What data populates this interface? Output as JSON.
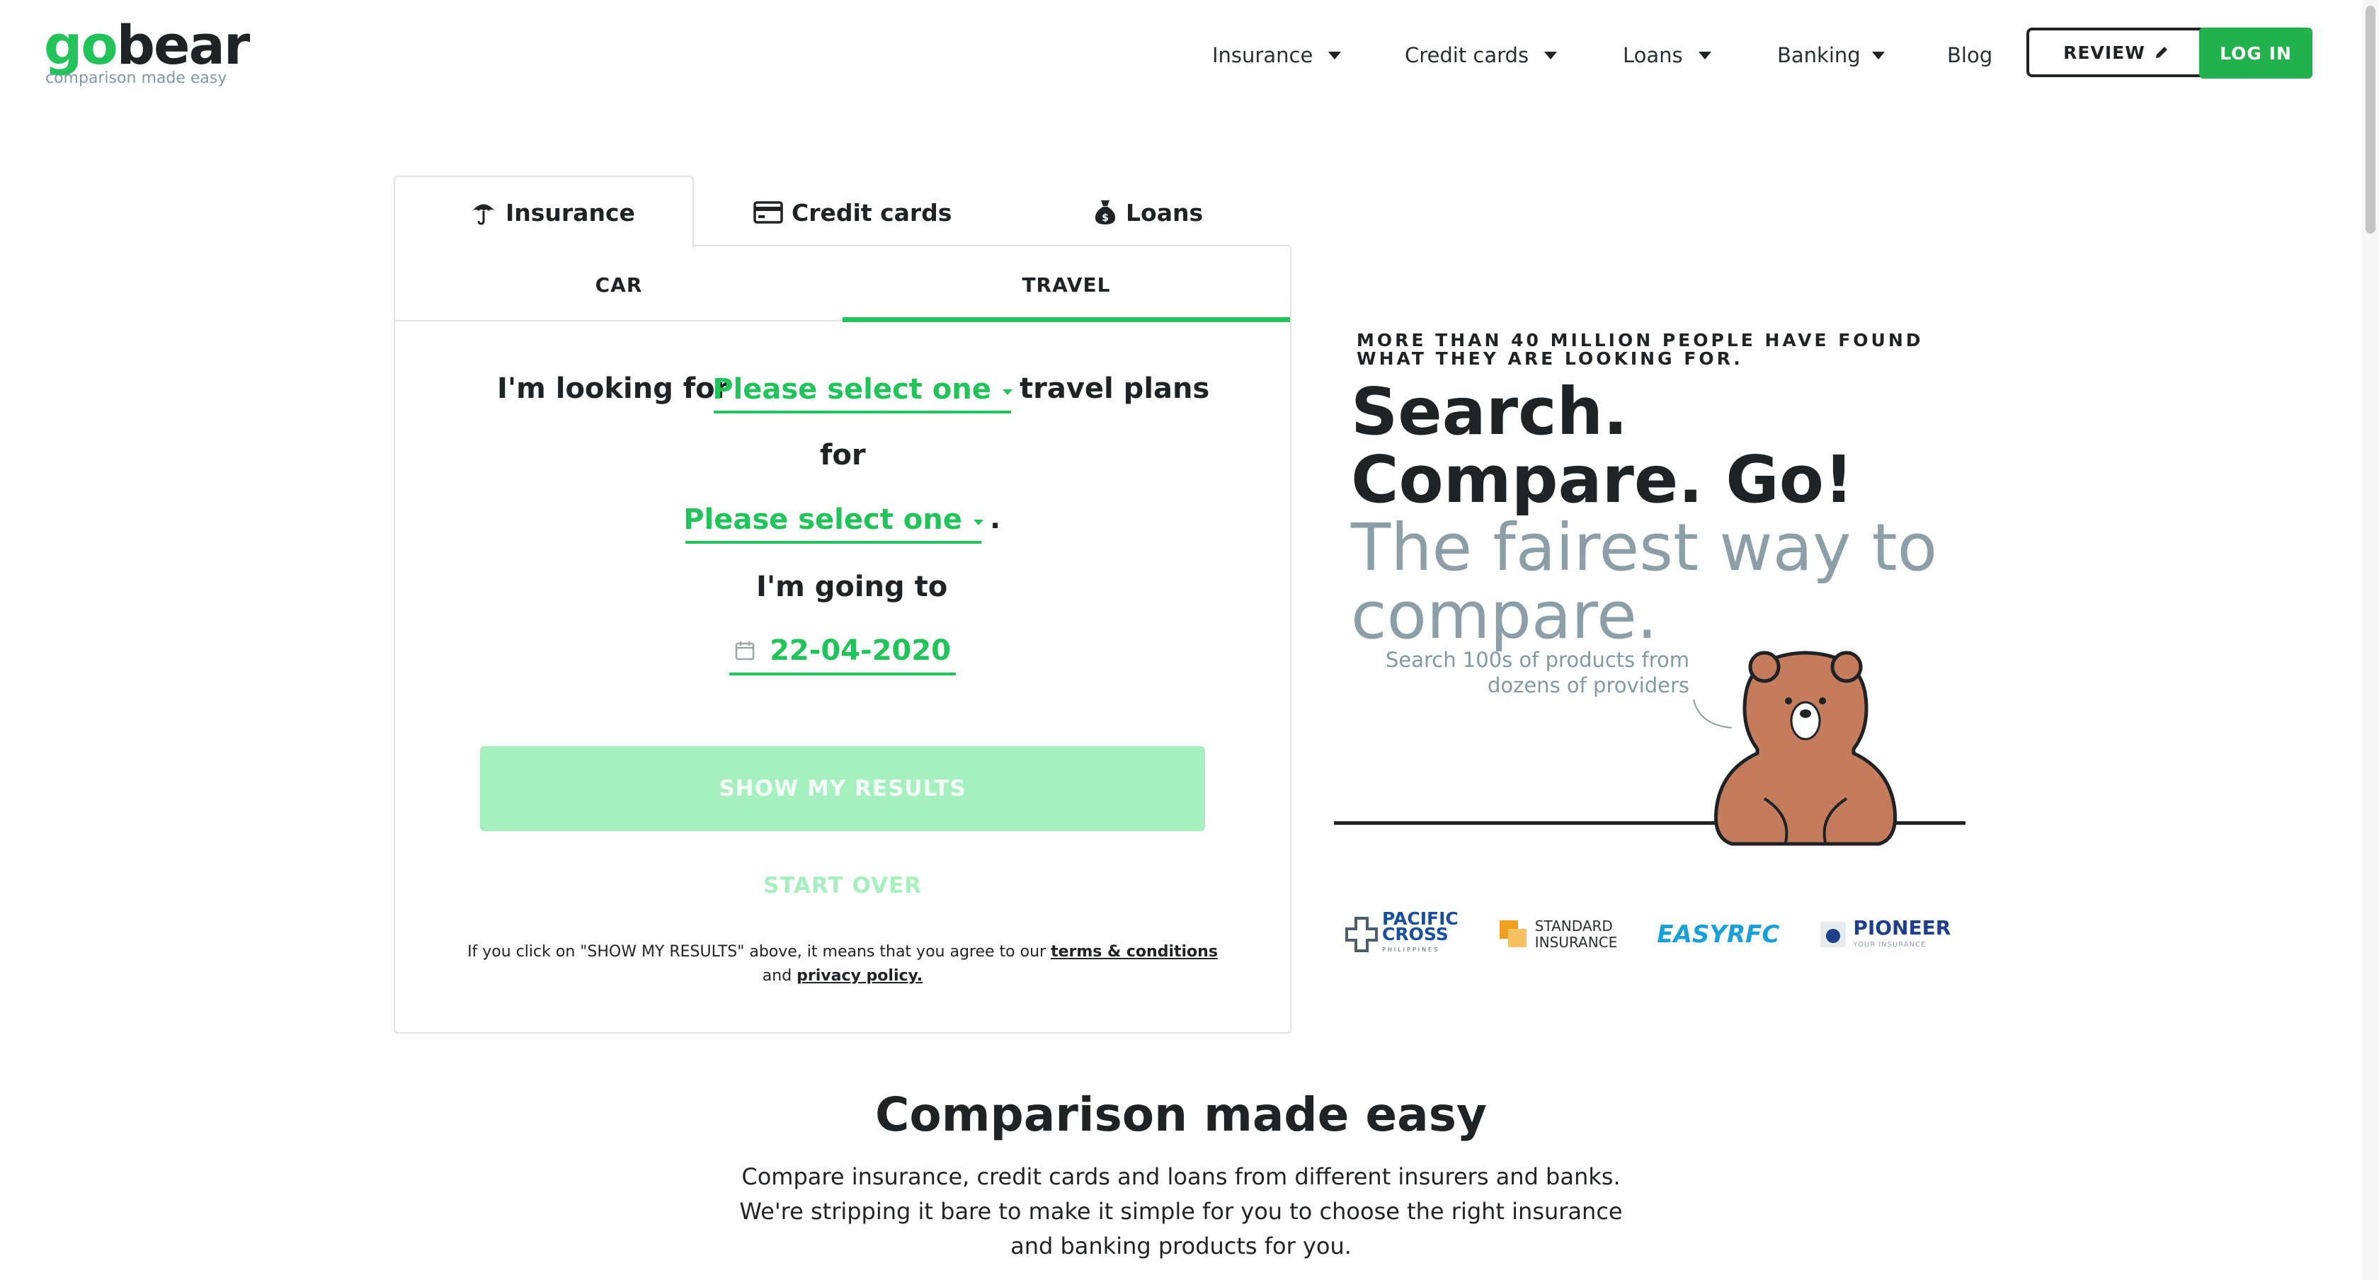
{
  "logo": {
    "word_go": "go",
    "word_bear": "bear",
    "tagline": "comparison made easy"
  },
  "nav": {
    "items": [
      {
        "label": "Insurance",
        "dropdown": true
      },
      {
        "label": "Credit cards",
        "dropdown": true
      },
      {
        "label": "Loans",
        "dropdown": true
      },
      {
        "label": "Banking",
        "dropdown": true
      },
      {
        "label": "Blog",
        "dropdown": false
      }
    ],
    "review_label": "REVIEW",
    "login_label": "LOG IN"
  },
  "search": {
    "tabs": [
      {
        "label": "Insurance",
        "icon": "umbrella-icon",
        "active": true
      },
      {
        "label": "Credit cards",
        "icon": "credit-card-icon",
        "active": false
      },
      {
        "label": "Loans",
        "icon": "money-bag-icon",
        "active": false
      }
    ],
    "subtabs": [
      {
        "label": "CAR",
        "active": false
      },
      {
        "label": "TRAVEL",
        "active": true
      }
    ],
    "form": {
      "prefix": "I'm looking for",
      "plan_select": "Please select one",
      "suffix": "travel plans",
      "for_text": "for",
      "who_select": "Please select one",
      "period": ".",
      "going_to": "I'm going to",
      "date": "22-04-2020"
    },
    "show_results_label": "SHOW MY RESULTS",
    "start_over_label": "START OVER",
    "disclaimer": {
      "text_before": "If you click on \"SHOW MY RESULTS\" above, it means that you agree to our",
      "terms_link": "terms & conditions",
      "and_text": "and",
      "privacy_link": "privacy policy."
    }
  },
  "hero": {
    "eyebrow": "MORE THAN 40 MILLION PEOPLE HAVE FOUND WHAT THEY ARE LOOKING FOR.",
    "headline_strong": "Search. Compare. Go!",
    "headline_light": "The fairest way to compare.",
    "bear_caption": "Search 100s of products from dozens of providers",
    "partners": [
      {
        "line1": "PACIFIC",
        "line2": "CROSS",
        "line3": "PHILIPPINES",
        "icon": "pacific-cross-logo"
      },
      {
        "line1": "STANDARD",
        "line2": "INSURANCE",
        "icon": "standard-insurance-logo"
      },
      {
        "line1": "EASYRFC",
        "icon": "easyrfc-logo"
      },
      {
        "line1": "PIONEER",
        "line2": "YOUR INSURANCE",
        "icon": "pioneer-logo"
      }
    ]
  },
  "section": {
    "title": "Comparison made easy",
    "text": "Compare insurance, credit cards and loans from different insurers and banks. We're stripping it bare to make it simple for you to choose the right insurance and banking products for you."
  },
  "colors": {
    "brand_green": "#22c35a",
    "button_green": "#22b14c",
    "disabled_green": "#a6efbe",
    "muted_blue_gray": "#8c9ea8",
    "bear_brown": "#c47c5c",
    "text_dark": "#1f2326"
  }
}
